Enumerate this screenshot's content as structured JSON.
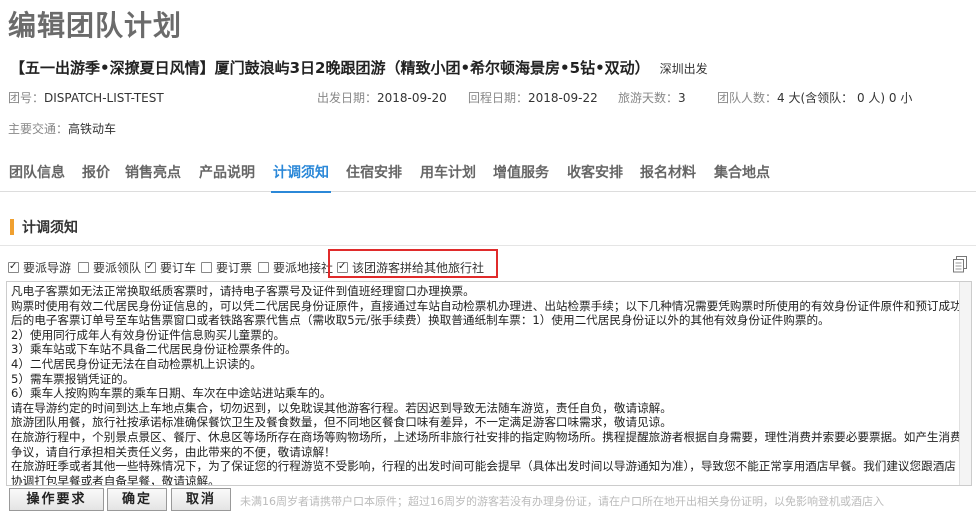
{
  "page": {
    "title": "编辑团队计划"
  },
  "tour": {
    "title": "【五一出游季•深撩夏日风情】厦门鼓浪屿3日2晚跟团游（精致小团•希尔顿海景房•5钻•双动）",
    "departure_city": "深圳出发"
  },
  "meta": {
    "team_no_label": "团号：",
    "team_no": "DISPATCH-LIST-TEST",
    "depart_label": "出发日期：",
    "depart_date": "2018-09-20",
    "return_label": "回程日期：",
    "return_date": "2018-09-22",
    "days_label": "旅游天数：",
    "days": "3",
    "people_label": "团队人数：",
    "people": "4 大(含领队： 0 人) 0 小",
    "traffic_label": "主要交通：",
    "traffic": "高铁动车"
  },
  "tabs": [
    {
      "label": "团队信息"
    },
    {
      "label": "报价"
    },
    {
      "label": "销售亮点"
    },
    {
      "label": "产品说明"
    },
    {
      "label": "计调须知"
    },
    {
      "label": "住宿安排"
    },
    {
      "label": "用车计划"
    },
    {
      "label": "增值服务"
    },
    {
      "label": "收客安排"
    },
    {
      "label": "报名材料"
    },
    {
      "label": "集合地点"
    }
  ],
  "active_tab": "计调须知",
  "section": {
    "title": "计调须知"
  },
  "checkboxes": [
    {
      "label": "要派导游",
      "checked": true
    },
    {
      "label": "要派领队",
      "checked": false
    },
    {
      "label": "要订车",
      "checked": true
    },
    {
      "label": "要订票",
      "checked": false
    },
    {
      "label": "要派地接社",
      "checked": false
    },
    {
      "label": "该团游客拼给其他旅行社",
      "checked": true
    }
  ],
  "notes": [
    "凡电子客票如无法正常换取纸质客票时，请持电子客票号及证件到值班经理窗口办理换票。",
    "购票时使用有效二代居民身份证信息的，可以凭二代居民身份证原件，直接通过车站自动检票机办理进、出站检票手续；以下几种情况需要凭购票时所使用的有效身份证件原件和预订成功后的电子客票订单号至车站售票窗口或者铁路客票代售点（需收取5元/张手续费）换取普通纸制车票：1）使用二代居民身份证以外的其他有效身份证件购票的。",
    "2）使用同行成年人有效身份证件信息购买儿童票的。",
    "3）乘车站或下车站不具备二代居民身份证检票条件的。",
    "4）二代居民身份证无法在自动检票机上识读的。",
    "5）需车票报销凭证的。",
    "6）乘车人按购购车票的乘车日期、车次在中途站进站乘车的。",
    "请在导游约定的时间到达上车地点集合，切勿迟到，以免耽误其他游客行程。若因迟到导致无法随车游览，责任自负，敬请谅解。",
    "旅游团队用餐，旅行社按承诺标准确保餐饮卫生及餐食数量，但不同地区餐食口味有差异，不一定满足游客口味需求，敬请见谅。",
    "在旅游行程中，个别景点景区、餐厅、休息区等场所存在商场等购物场所，上述场所非旅行社安排的指定购物场所。携程提醒旅游者根据自身需要，理性消费并索要必要票据。如产生消费争议，请自行承担相关责任义务，由此带来的不便，敬请谅解！",
    "在旅游旺季或者其他一些特殊情况下，为了保证您的行程游览不受影响，行程的出发时间可能会提早（具体出发时间以导游通知为准），导致您不能正常享用酒店早餐。我们建议您跟酒店协调打包早餐或者自备早餐，敬请谅解。"
  ],
  "footer": {
    "faded_text": "未满16周岁者请携带户口本原件；超过16周岁的游客若没有办理身份证，请在户口所在地开出相关身份证明，以免影响登机或酒店入",
    "buttons": [
      {
        "label": "操作要求"
      },
      {
        "label": "确定"
      },
      {
        "label": "取消"
      }
    ]
  }
}
